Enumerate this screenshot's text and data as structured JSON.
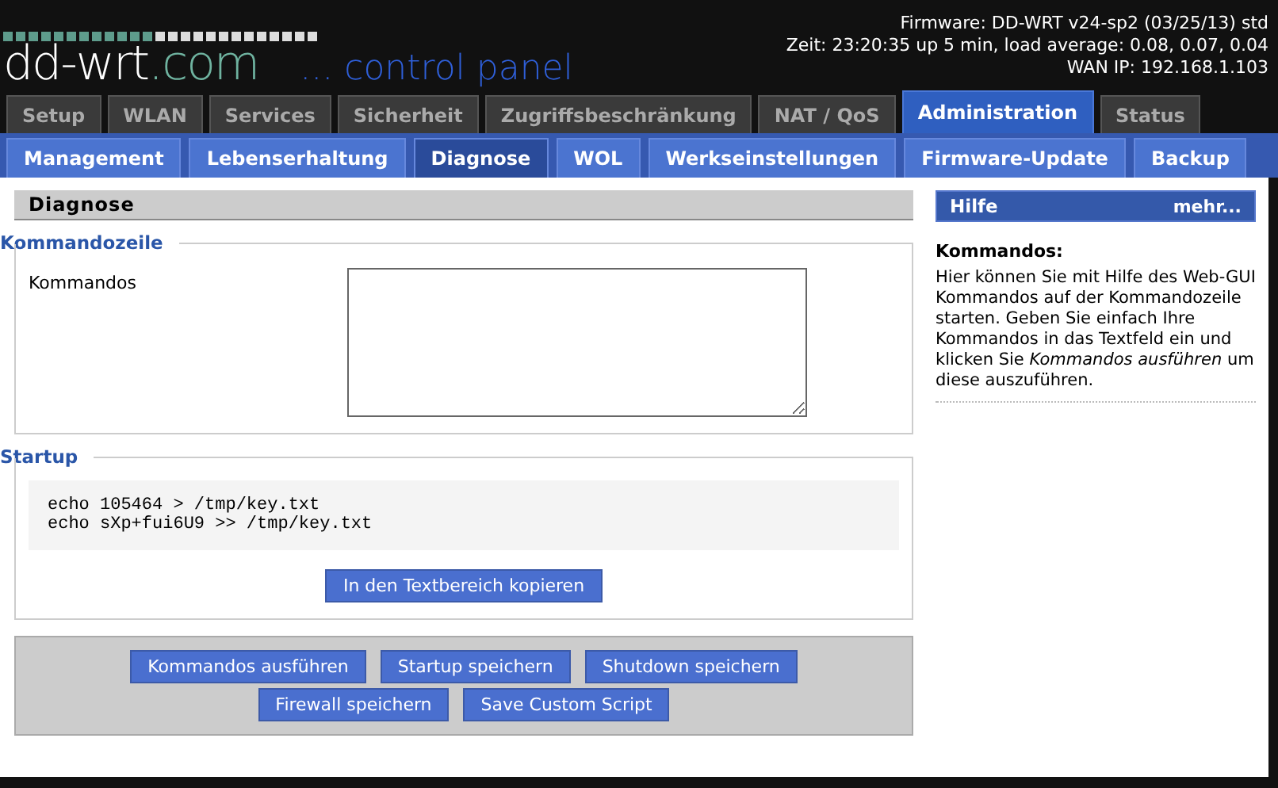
{
  "header": {
    "logo_main": "dd-wrt",
    "logo_suffix": ".com",
    "subtitle": "... control panel",
    "info": [
      "Firmware: DD-WRT v24-sp2 (03/25/13) std",
      "Zeit: 23:20:35 up 5 min, load average: 0.08, 0.07, 0.04",
      "WAN IP: 192.168.1.103"
    ]
  },
  "tabs": [
    {
      "label": "Setup",
      "selected": false
    },
    {
      "label": "WLAN",
      "selected": false
    },
    {
      "label": "Services",
      "selected": false
    },
    {
      "label": "Sicherheit",
      "selected": false
    },
    {
      "label": "Zugriffsbeschränkung",
      "selected": false
    },
    {
      "label": "NAT / QoS",
      "selected": false
    },
    {
      "label": "Administration",
      "selected": true
    },
    {
      "label": "Status",
      "selected": false
    }
  ],
  "subtabs": [
    {
      "label": "Management",
      "selected": false
    },
    {
      "label": "Lebenserhaltung",
      "selected": false
    },
    {
      "label": "Diagnose",
      "selected": true
    },
    {
      "label": "WOL",
      "selected": false
    },
    {
      "label": "Werkseinstellungen",
      "selected": false
    },
    {
      "label": "Firmware-Update",
      "selected": false
    },
    {
      "label": "Backup",
      "selected": false
    }
  ],
  "main": {
    "title": "Diagnose",
    "commandline": {
      "legend": "Kommandozeile",
      "label": "Kommandos"
    },
    "startup": {
      "legend": "Startup",
      "lines": [
        "echo 105464 > /tmp/key.txt",
        "echo sXp+fui6U9 >> /tmp/key.txt"
      ],
      "copy_button": "In den Textbereich kopieren"
    },
    "buttons": [
      "Kommandos ausführen",
      "Startup speichern",
      "Shutdown speichern",
      "Firewall speichern",
      "Save Custom Script"
    ]
  },
  "help": {
    "title": "Hilfe",
    "more": "mehr...",
    "heading": "Kommandos:",
    "text": "Hier können Sie mit Hilfe des Web-GUI Kommandos auf der Kommandozeile starten. Geben Sie einfach Ihre Kommandos in das Textfeld ein und klicken Sie *Kommandos ausführen* um diese auszuführen."
  }
}
